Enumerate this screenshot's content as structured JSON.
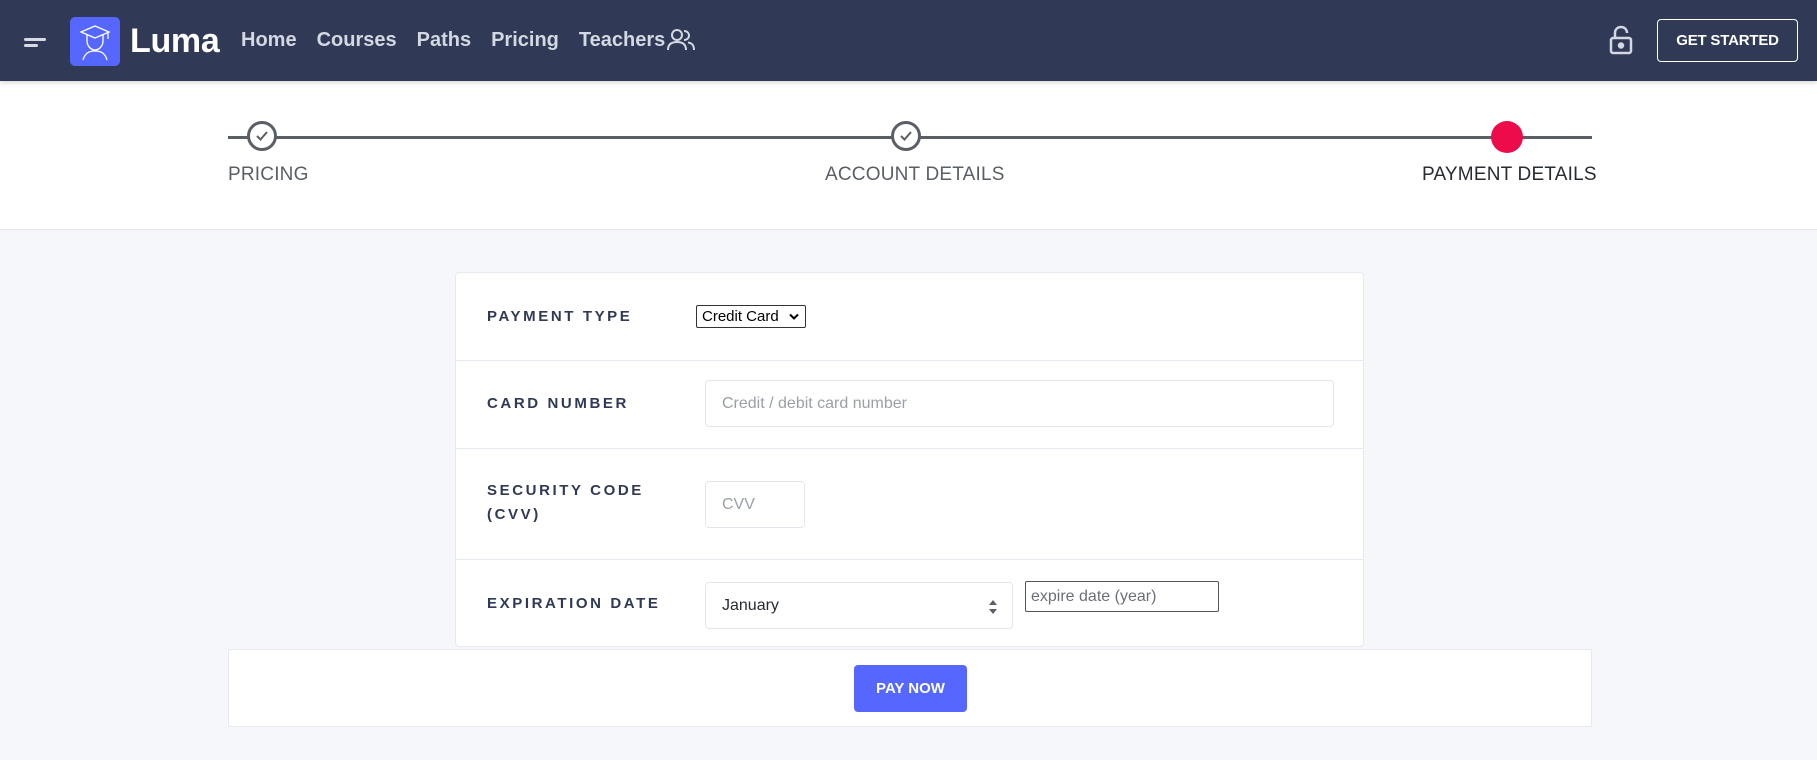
{
  "navbar": {
    "brand": "Luma",
    "links": [
      "Home",
      "Courses",
      "Paths",
      "Pricing",
      "Teachers"
    ],
    "get_started": "GET STARTED"
  },
  "stepper": {
    "steps": [
      {
        "label": "PRICING",
        "state": "completed"
      },
      {
        "label": "ACCOUNT DETAILS",
        "state": "completed"
      },
      {
        "label": "PAYMENT DETAILS",
        "state": "active"
      }
    ],
    "active_color": "#ed0b4c"
  },
  "form": {
    "payment_type": {
      "label": "PAYMENT TYPE",
      "value": "Credit Card"
    },
    "card_number": {
      "label": "CARD NUMBER",
      "placeholder": "Credit / debit card number"
    },
    "security_code": {
      "label_line1": "SECURITY CODE",
      "label_line2": "(CVV)",
      "placeholder": "CVV"
    },
    "expiration": {
      "label": "EXPIRATION DATE",
      "month": "January",
      "year_placeholder": "expire date (year)"
    }
  },
  "pay_button": "PAY NOW",
  "colors": {
    "navbar": "#303956",
    "primary": "#5567ff",
    "accent": "#ed0b4c"
  },
  "icons": [
    "menu-icon",
    "graduate-logo-icon",
    "people-icon",
    "lock-icon",
    "check-icon",
    "chevron-down-icon",
    "sort-updown-icon"
  ]
}
